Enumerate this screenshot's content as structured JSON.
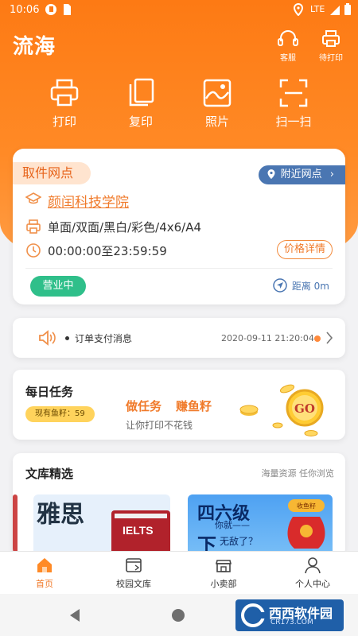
{
  "status_bar": {
    "time": "10:06",
    "network": "LTE"
  },
  "header": {
    "brand": "流海",
    "actions": [
      {
        "label": "客服",
        "icon": "headset-icon"
      },
      {
        "label": "待打印",
        "icon": "printer-icon"
      }
    ]
  },
  "quick_actions": [
    {
      "label": "打印",
      "icon": "printer-icon"
    },
    {
      "label": "复印",
      "icon": "copy-icon"
    },
    {
      "label": "照片",
      "icon": "photo-icon"
    },
    {
      "label": "扫一扫",
      "icon": "scan-icon"
    }
  ],
  "pickup": {
    "tag": "取件网点",
    "nearby": "附近网点",
    "school": "颜闰科技学院",
    "specs": "单面/双面/黑白/彩色/4x6/A4",
    "hours": "00:00:00至23:59:59",
    "price_button": "价格详情",
    "status": "营业中",
    "distance": "距离 0m"
  },
  "notice": {
    "message": "订单支付消息",
    "date": "2020-09-11 21:20:04"
  },
  "task": {
    "title": "每日任务",
    "fish": "现有鱼籽：59",
    "do_task": "做任务",
    "earn": "赚鱼籽",
    "subtitle": "让你打印不花钱",
    "go": "GO"
  },
  "library": {
    "title": "文库精选",
    "hint": "海量资源 任你浏览",
    "banners": [
      {
        "text": "雅思",
        "extra": "IELTS"
      },
      {
        "text": "四六级",
        "line2": "下",
        "line3": "无敌了？",
        "line4": "你就——",
        "badge": "收鱼籽"
      }
    ]
  },
  "tabbar": [
    {
      "label": "首页",
      "icon": "home-icon",
      "active": true
    },
    {
      "label": "校园文库",
      "icon": "library-icon",
      "active": false
    },
    {
      "label": "小卖部",
      "icon": "shop-icon",
      "active": false
    },
    {
      "label": "个人中心",
      "icon": "user-icon",
      "active": false
    }
  ],
  "watermark": {
    "text": "西西软件园",
    "url": "CR173.COM"
  },
  "colors": {
    "brand": "#fd7a14",
    "accent_blue": "#4a76b2",
    "open_green": "#2fbf8a"
  }
}
